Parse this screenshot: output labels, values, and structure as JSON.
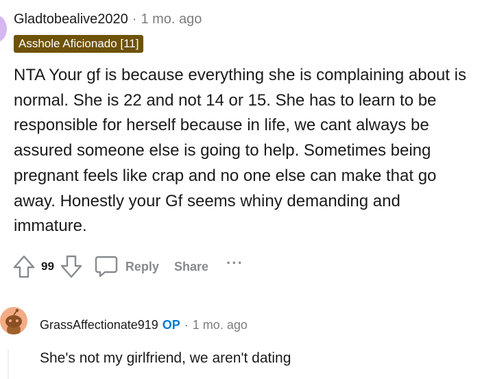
{
  "comment": {
    "username": "Gladtobealive2020",
    "separator": "·",
    "time": "1 mo. ago",
    "flair": "Asshole Aficionado [11]",
    "body": "NTA Your gf is because everything she is complaining about is normal. She is 22 and not 14 or 15. She has to learn to be responsible for herself because in life, we cant always be assured someone else is going to help. Sometimes being pregnant feels like crap and no one else can make that go away. Honestly your Gf seems whiny demanding and immature.",
    "votes": "99",
    "reply_label": "Reply",
    "share_label": "Share",
    "more_label": "···"
  },
  "reply": {
    "username": "GrassAffectionate919",
    "op_badge": "OP",
    "separator": "·",
    "time": "1 mo. ago",
    "body": "She's not my girlfriend, we aren't dating"
  },
  "colors": {
    "flair_bg": "#6e5208",
    "op_badge": "#0079d3",
    "meta_gray": "#7c7c7c",
    "action_gray": "#878a8c",
    "avatar1_bg": "#d6b7f0",
    "avatar2_bg": "#f3ac85"
  },
  "icons": {
    "upvote": "upvote-arrow-icon",
    "downvote": "downvote-arrow-icon",
    "reply": "speech-bubble-icon",
    "more": "ellipsis-icon",
    "avatar": "snoo-avatar-icon"
  }
}
